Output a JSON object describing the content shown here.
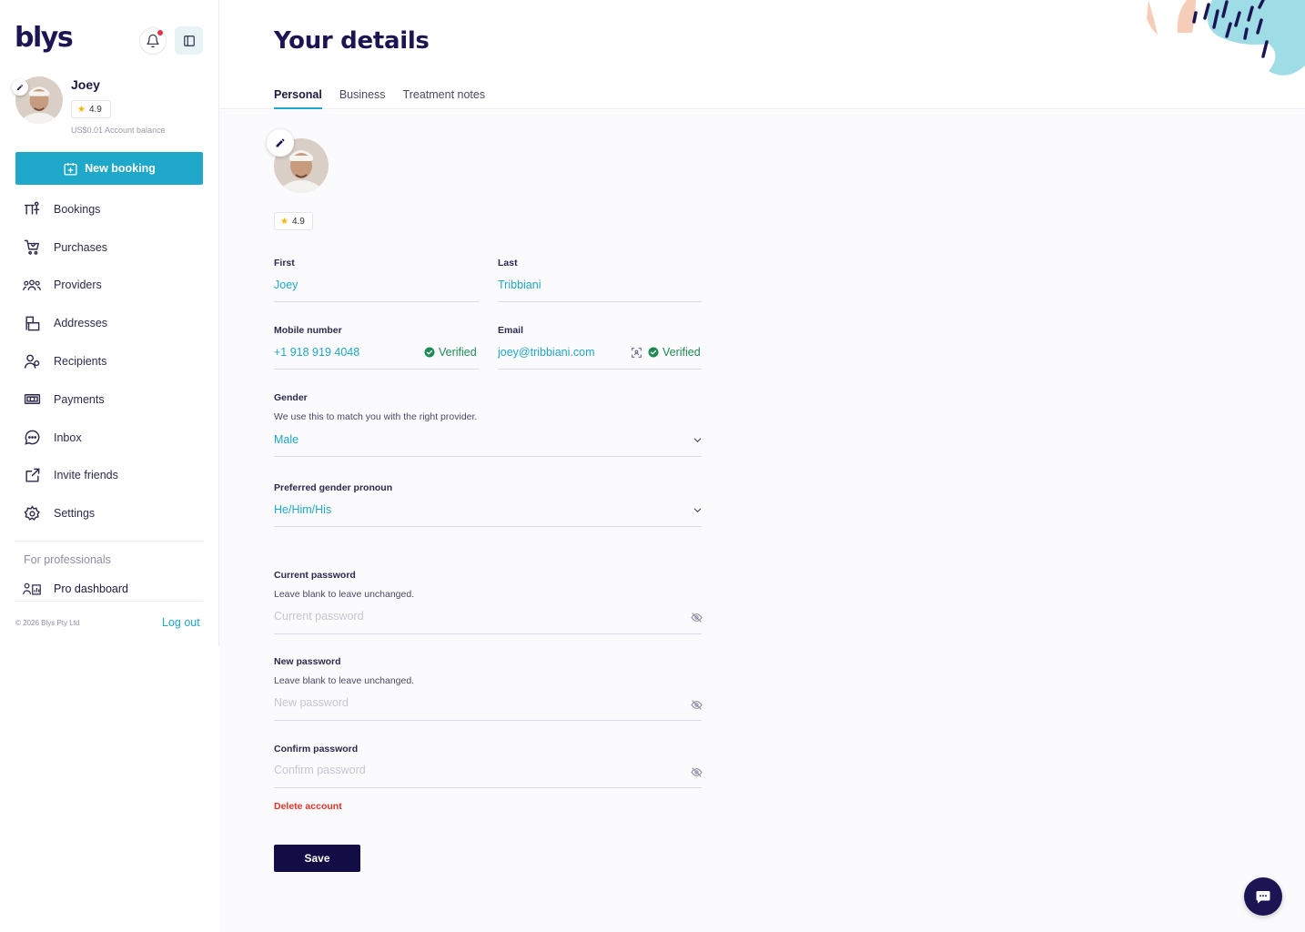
{
  "brand": {
    "logo_text": "blys"
  },
  "header_icons": {
    "bell": "bell-icon",
    "panel": "sidebar-toggle-icon"
  },
  "user": {
    "name": "Joey",
    "rating": "4.9",
    "balance": "US$0.01 Account balance"
  },
  "sidebar": {
    "new_booking_label": "New booking",
    "items": [
      {
        "label": "Bookings",
        "icon": "massage-table-icon"
      },
      {
        "label": "Purchases",
        "icon": "cart-icon"
      },
      {
        "label": "Providers",
        "icon": "group-icon"
      },
      {
        "label": "Addresses",
        "icon": "address-icon"
      },
      {
        "label": "Recipients",
        "icon": "recipients-icon"
      },
      {
        "label": "Payments",
        "icon": "money-icon"
      },
      {
        "label": "Inbox",
        "icon": "chat-bubble-icon"
      },
      {
        "label": "Invite friends",
        "icon": "share-icon"
      },
      {
        "label": "Settings",
        "icon": "gear-icon"
      }
    ],
    "for_professionals": "For professionals",
    "pro_dashboard": "Pro dashboard",
    "copyright": "© 2026 Blys Pty Ltd",
    "logout": "Log out"
  },
  "page": {
    "title": "Your details",
    "tabs": [
      "Personal",
      "Business",
      "Treatment notes"
    ],
    "active_tab": "Personal"
  },
  "profile": {
    "rating": "4.9"
  },
  "form": {
    "first": {
      "label": "First",
      "value": "Joey"
    },
    "last": {
      "label": "Last",
      "value": "Tribbiani"
    },
    "mobile": {
      "label": "Mobile number",
      "value": "+1 918 919 4048",
      "status": "Verified"
    },
    "email": {
      "label": "Email",
      "value": "joey@tribbiani.com",
      "status": "Verified"
    },
    "gender": {
      "label": "Gender",
      "help": "We use this to match you with the right provider.",
      "value": "Male"
    },
    "pronoun": {
      "label": "Preferred gender pronoun",
      "value": "He/Him/His"
    },
    "current_password": {
      "label": "Current password",
      "help": "Leave blank to leave unchanged.",
      "placeholder": "Current password"
    },
    "new_password": {
      "label": "New password",
      "help": "Leave blank to leave unchanged.",
      "placeholder": "New password"
    },
    "confirm_password": {
      "label": "Confirm password",
      "placeholder": "Confirm password"
    },
    "delete_account": "Delete account",
    "save": "Save"
  },
  "colors": {
    "accent": "#1fa8c9",
    "navy": "#1c1554",
    "verified": "#1e8a55",
    "danger": "#e0332a"
  }
}
